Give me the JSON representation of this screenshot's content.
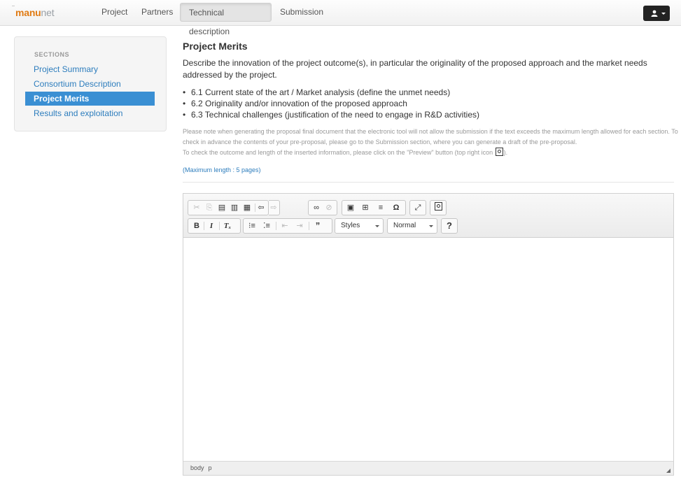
{
  "brand": {
    "part1": "manu",
    "part2": "net"
  },
  "nav": {
    "items": [
      {
        "label": "Project",
        "active": false
      },
      {
        "label": "Partners",
        "active": false
      },
      {
        "label": "Technical description",
        "active": true
      },
      {
        "label": "Submission",
        "active": false
      }
    ],
    "user_icon": "user-icon"
  },
  "sidebar": {
    "header": "SECTIONS",
    "items": [
      {
        "label": "Project Summary",
        "active": false
      },
      {
        "label": "Consortium Description",
        "active": false
      },
      {
        "label": "Project Merits",
        "active": true
      },
      {
        "label": "Results and exploitation",
        "active": false
      }
    ]
  },
  "main": {
    "title": "Project Merits",
    "description": "Describe the innovation of the project outcome(s), in particular the originality of the proposed approach and the market needs addressed by the project.",
    "bullets": [
      "6.1 Current state of the art / Market analysis (define the unmet needs)",
      "6.2 Originality and/or innovation of the proposed approach",
      "6.3 Technical challenges (justification of the need to engage in R&D activities)"
    ],
    "note_line1": "Please note when generating the proposal final document that the electronic tool will not allow the submission if the text exceeds the maximum length allowed for each section. To check in advance the contents of your pre-proposal, please go to the Submission section, where you can generate a draft of the pre-proposal.",
    "note_line2_a": "To check the outcome and length of the inserted information, please click on the \"Preview\" button (top right icon",
    "note_line2_b": ").",
    "max_length": "(Maximum length : 5 pages)"
  },
  "editor": {
    "styles_label": "Styles",
    "format_label": "Normal",
    "help_label": "?",
    "status_path": [
      "body",
      "p"
    ],
    "toolbar_icons": [
      "cut-icon",
      "copy-icon",
      "paste-icon",
      "paste-text-icon",
      "paste-word-icon",
      "undo-icon",
      "redo-icon",
      "link-icon",
      "unlink-icon",
      "image-icon",
      "table-icon",
      "horizontal-line-icon",
      "special-char-icon",
      "maximize-icon",
      "preview-icon",
      "bold-icon",
      "italic-icon",
      "remove-format-icon",
      "numbered-list-icon",
      "bulleted-list-icon",
      "outdent-icon",
      "indent-icon",
      "blockquote-icon"
    ]
  }
}
